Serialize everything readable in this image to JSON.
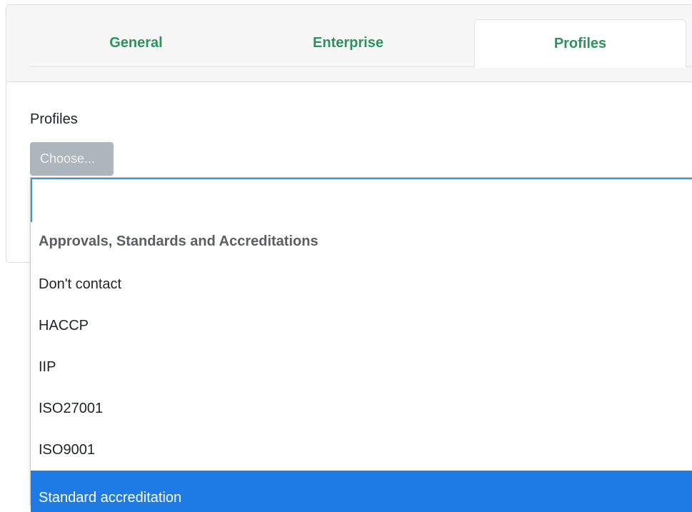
{
  "tabs": {
    "general": "General",
    "enterprise": "Enterprise",
    "profiles": "Profiles"
  },
  "form": {
    "label": "Profiles",
    "choose_button": "Choose..."
  },
  "dropdown": {
    "search_value": "",
    "group_header": "Approvals, Standards and Accreditations",
    "options": [
      "Don't contact",
      "HACCP",
      "IIP",
      "ISO27001",
      "ISO9001",
      "Standard accreditation"
    ],
    "highlighted_option": "Standard accreditation"
  },
  "colors": {
    "tab_text": "#28965a",
    "highlight": "#1e7be6",
    "focus_border": "#3a95e0",
    "button_bg": "#adb5bd"
  }
}
